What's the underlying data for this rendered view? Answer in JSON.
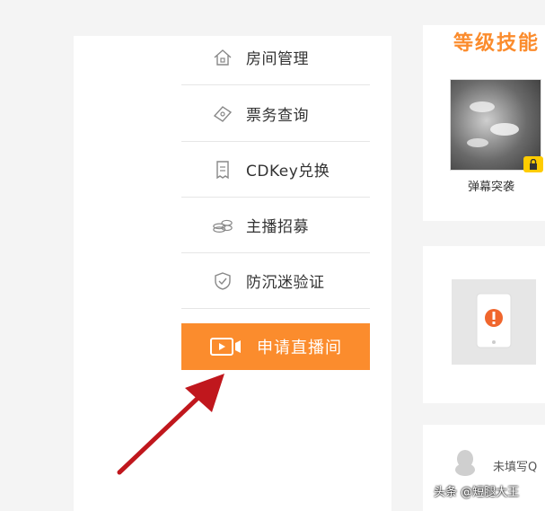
{
  "menu": {
    "items": [
      {
        "label": "房间管理",
        "icon": "house-icon"
      },
      {
        "label": "票务查询",
        "icon": "ticket-icon"
      },
      {
        "label": "CDKey兑换",
        "icon": "receipt-icon"
      },
      {
        "label": "主播招募",
        "icon": "coins-icon"
      },
      {
        "label": "防沉迷验证",
        "icon": "shield-check-icon"
      }
    ],
    "apply_button": {
      "label": "申请直播间",
      "icon": "video-camera-icon"
    }
  },
  "right": {
    "level_title": "等级技能",
    "skill_label": "弹幕突袭",
    "qq_text": "未填写Q"
  },
  "watermark": "头条 @短腿大王",
  "colors": {
    "accent": "#fb8c2d",
    "arrow": "#c0171d"
  }
}
